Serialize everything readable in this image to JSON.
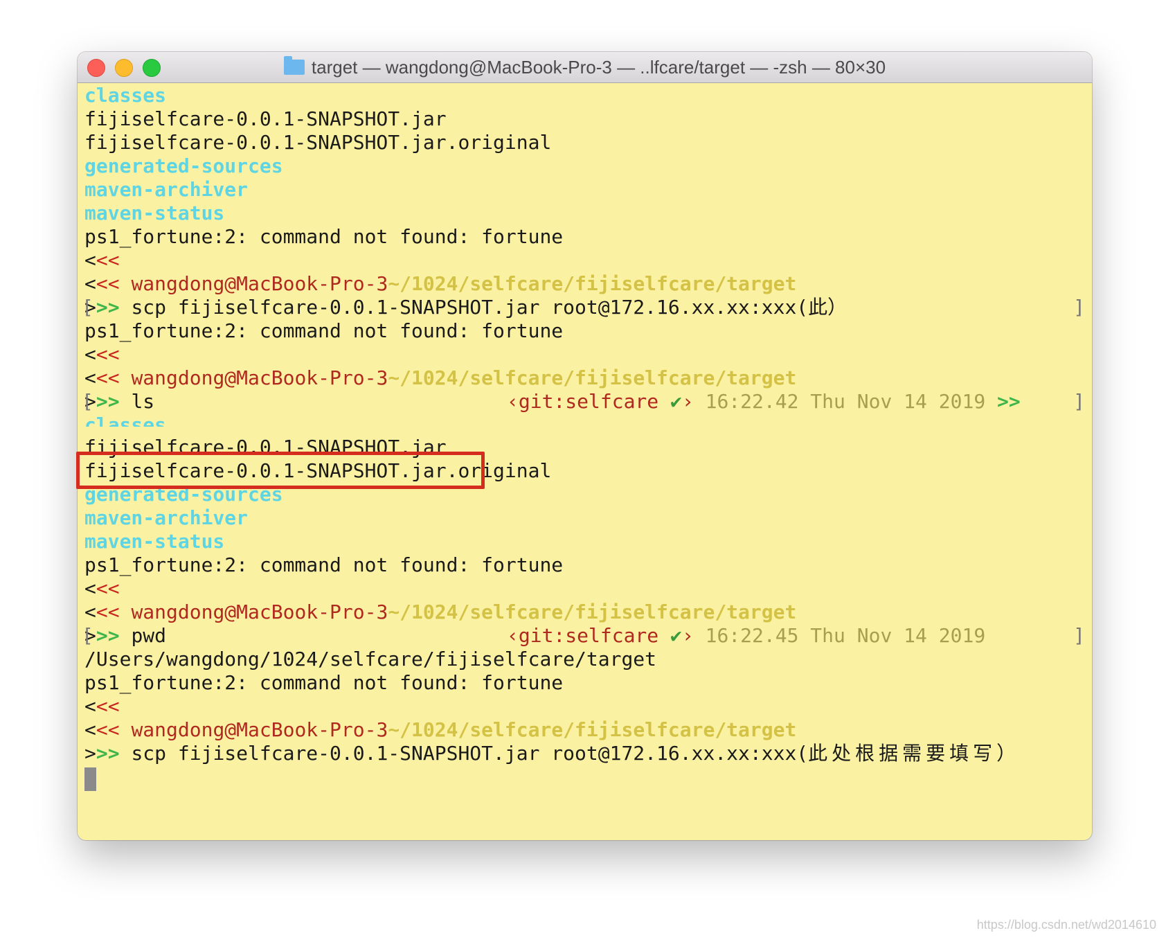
{
  "window": {
    "title": "target — wangdong@MacBook-Pro-3 — ..lfcare/target — -zsh — 80×30",
    "folder_icon": "folder-icon",
    "background": "#fbf1a3"
  },
  "terminal": {
    "ls1": {
      "dir_classes": "classes",
      "file_jar": "fijiselfcare-0.0.1-SNAPSHOT.jar",
      "file_original": "fijiselfcare-0.0.1-SNAPSHOT.jar.original",
      "dir_generated": "generated-sources",
      "dir_archiver": "maven-archiver",
      "dir_status": "maven-status"
    },
    "fortune_error": "ps1_fortune:2: command not found: fortune",
    "prompt_left_a": "<",
    "prompt_left_b": "<<",
    "prompt_left_c": "<",
    "prompt_left_d": "<<",
    "user_host": "wangdong@MacBook-Pro-3",
    "cwd": "~/1024/selfcare/fijiselfcare/target",
    "prompt_arrow_a": ">",
    "prompt_arrow_b": ">>",
    "cmd1": "scp fijiselfcare-0.0.1-SNAPSHOT.jar root@172.16.xx.xx:xxx(此）",
    "cmd2": "ls",
    "cmd3": "pwd",
    "cmd4_ascii": "scp fijiselfcare-0.0.1-SNAPSHOT.jar root@172.16.xx.xx:xxx(",
    "cmd4_cjk": "此处根据需要填写）",
    "git_open": "‹git:selfcare ",
    "git_check": "✔",
    "git_close": "›",
    "time_ls": "16:22.42 Thu Nov 14 2019",
    "time_pwd": "16:22.45 Thu Nov 14 2019",
    "trailing_arrows": ">>",
    "bracket_open": "[",
    "bracket_close": "]",
    "ls2": {
      "dir_classes": "classes",
      "file_jar": "fijiselfcare-0.0.1-SNAPSHOT.jar",
      "file_original": "fijiselfcare-0.0.1-SNAPSHOT.jar.original",
      "dir_generated": "generated-sources",
      "dir_archiver": "maven-archiver",
      "dir_status": "maven-status"
    },
    "pwd_output": "/Users/wangdong/1024/selfcare/fijiselfcare/target"
  },
  "watermark": "https://blog.csdn.net/wd2014610"
}
